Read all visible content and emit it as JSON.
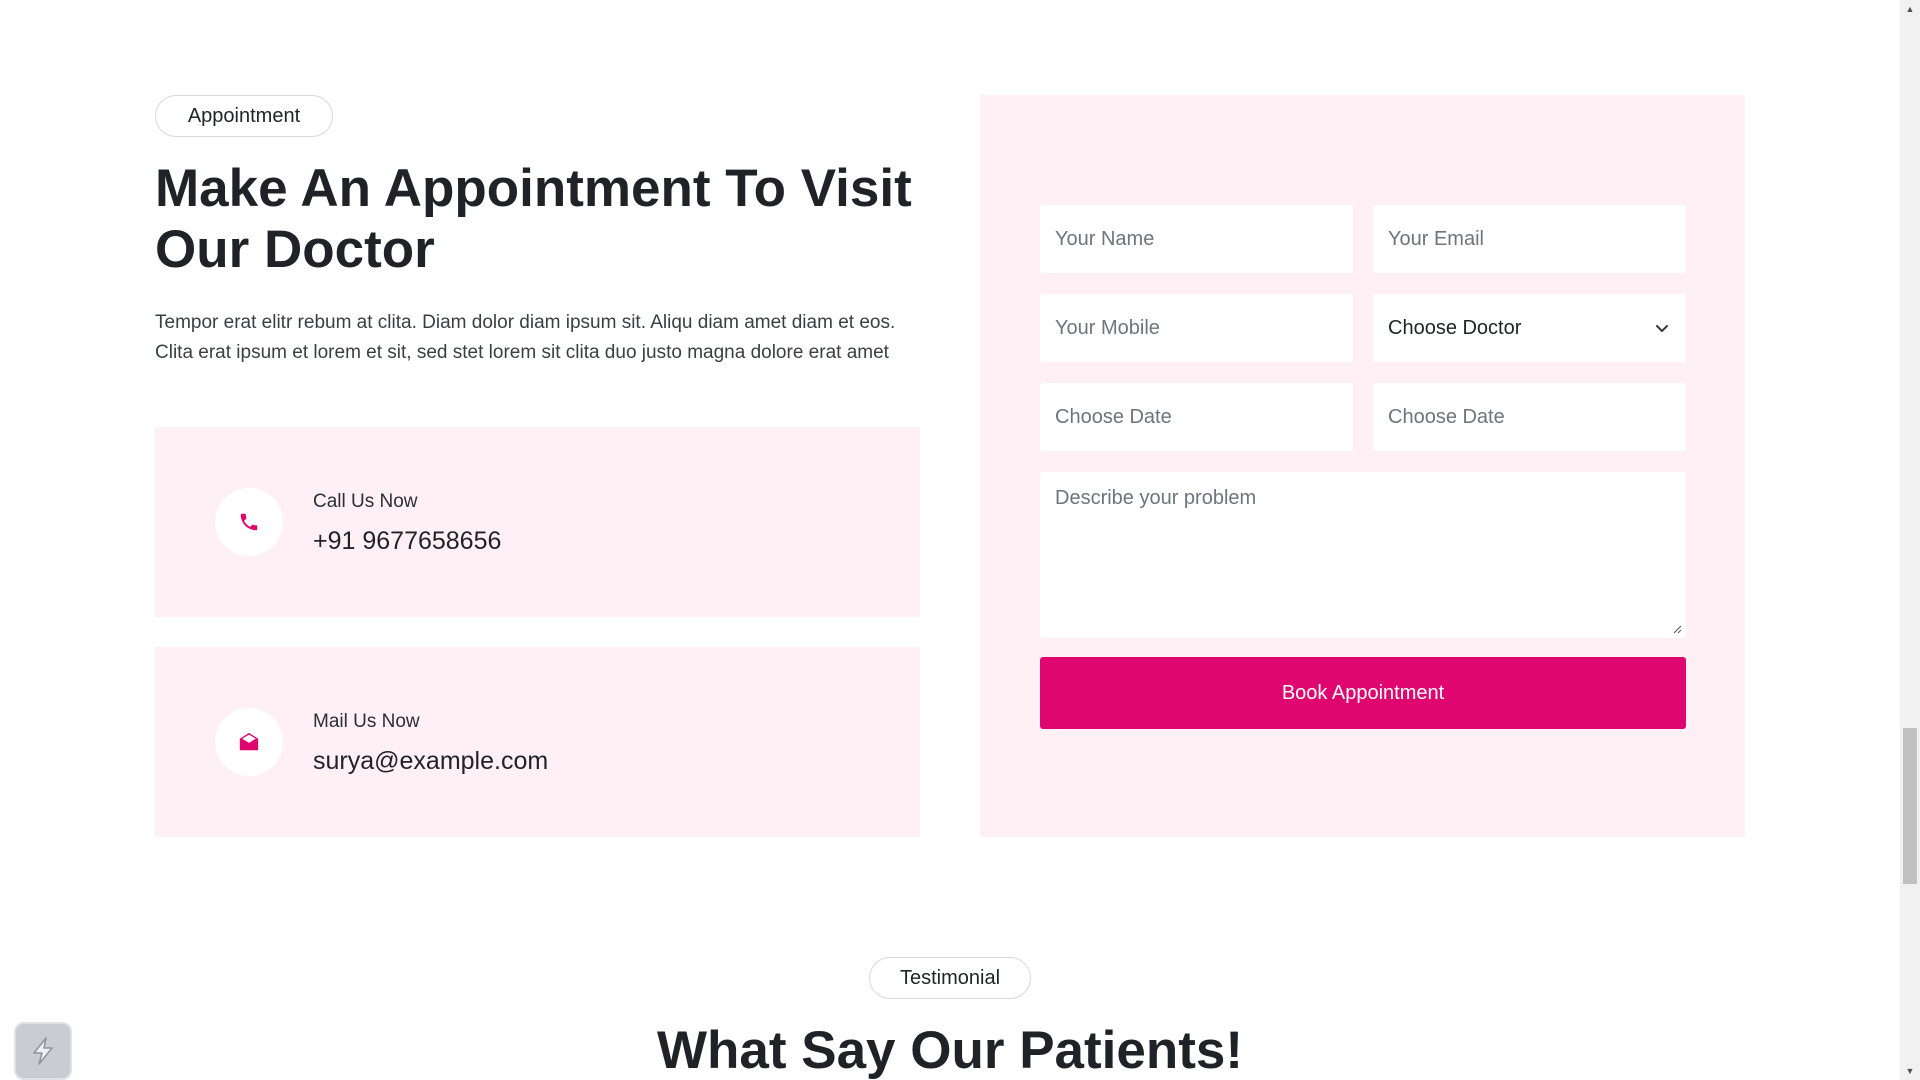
{
  "appointment": {
    "pill": "Appointment",
    "title": "Make An Appointment To Visit Our Doctor",
    "description": "Tempor erat elitr rebum at clita. Diam dolor diam ipsum sit. Aliqu diam amet diam et eos. Clita erat ipsum et lorem et sit, sed stet lorem sit clita duo justo magna dolore erat amet",
    "contacts": [
      {
        "label": "Call Us Now",
        "value": "+91 9677658656",
        "icon": "phone-icon"
      },
      {
        "label": "Mail Us Now",
        "value": "surya@example.com",
        "icon": "envelope-open-icon"
      }
    ]
  },
  "form": {
    "name_placeholder": "Your Name",
    "email_placeholder": "Your Email",
    "mobile_placeholder": "Your Mobile",
    "doctor_select": "Choose Doctor",
    "date_placeholder": "Choose Date",
    "time_placeholder": "Choose Date",
    "problem_placeholder": "Describe your problem",
    "submit_label": "Book Appointment"
  },
  "testimonial": {
    "pill": "Testimonial",
    "title": "What Say Our Patients!"
  },
  "colors": {
    "accent": "#e0066f",
    "card_background": "#fff0f6"
  }
}
